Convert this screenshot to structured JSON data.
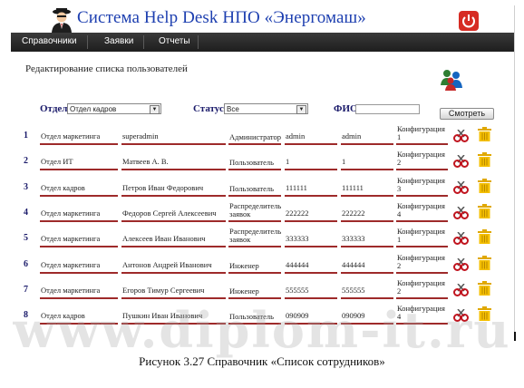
{
  "app": {
    "title": "Система Help Desk НПО «Энергомаш»"
  },
  "nav": {
    "items": [
      "Справочники",
      "Заявки",
      "Отчеты"
    ]
  },
  "page": {
    "title": "Редактирование списка пользователей"
  },
  "filters": {
    "department_label": "Отдел",
    "department_value": "Отдел кадров",
    "status_label": "Статус",
    "status_value": "Все",
    "fio_label": "ФИО",
    "fio_value": "",
    "show_button": "Смотреть"
  },
  "rows": [
    {
      "n": "1",
      "dept": "Отдел маркетинга",
      "fio": "superadmin",
      "role": "Администратор",
      "login": "admin",
      "pass": "admin",
      "conf": "Конфигурация 1"
    },
    {
      "n": "2",
      "dept": "Отдел ИТ",
      "fio": "Матвеев А. В.",
      "role": "Пользователь",
      "login": "1",
      "pass": "1",
      "conf": "Конфигурация 2"
    },
    {
      "n": "3",
      "dept": "Отдел кадров",
      "fio": "Петров Иван Федорович",
      "role": "Пользователь",
      "login": "111111",
      "pass": "111111",
      "conf": "Конфигурация 3"
    },
    {
      "n": "4",
      "dept": "Отдел маркетинга",
      "fio": "Федоров Сергей Алексеевич",
      "role": "Распределитель заявок",
      "login": "222222",
      "pass": "222222",
      "conf": "Конфигурация 4"
    },
    {
      "n": "5",
      "dept": "Отдел маркетинга",
      "fio": "Алексеев Иван Иванович",
      "role": "Распределитель заявок",
      "login": "333333",
      "pass": "333333",
      "conf": "Конфигурация 1"
    },
    {
      "n": "6",
      "dept": "Отдел маркетинга",
      "fio": "Антонов Андрей Иванович",
      "role": "Инженер",
      "login": "444444",
      "pass": "444444",
      "conf": "Конфигурация 2"
    },
    {
      "n": "7",
      "dept": "Отдел маркетинга",
      "fio": "Егоров Тимур Сергеевич",
      "role": "Инженер",
      "login": "555555",
      "pass": "555555",
      "conf": "Конфигурация 2"
    },
    {
      "n": "8",
      "dept": "Отдел кадров",
      "fio": "Пушкин Иван Иванович",
      "role": "Пользователь",
      "login": "090909",
      "pass": "090909",
      "conf": "Конфигурация 4"
    }
  ],
  "icons": {
    "delete": "delete-icon",
    "trash": "trash-icon",
    "power": "power-icon",
    "users": "users-icon",
    "logo": "user-avatar-icon"
  },
  "colors": {
    "title": "#1d3fb0",
    "navbar": "#2b2b2b",
    "row_underline": "#9e2a2a",
    "delete": "#c0141e",
    "trash": "#f0b800"
  },
  "watermark": "www.diplom-it.ru",
  "caption": "Рисунок 3.27 Справочник «Список сотрудников»"
}
